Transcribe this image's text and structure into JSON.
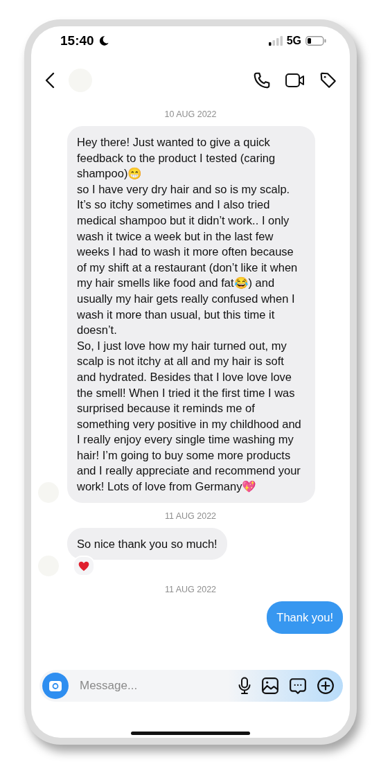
{
  "status_bar": {
    "time": "15:40",
    "network": "5G"
  },
  "messages": [
    {
      "kind": "date",
      "text": "10 AUG 2022"
    },
    {
      "kind": "incoming",
      "text": "Hey there! Just wanted to give a quick feedback to the product I tested (caring shampoo)😁\nso I have very dry hair and so is my scalp. It’s so itchy sometimes and I also tried medical shampoo but it didn’t work.. I only wash it twice a week but in the last few weeks I had to wash it more often because of my shift at a restaurant (don’t like it when my hair smells like food and fat😂) and usually my hair gets really confused when I wash it more than usual, but this time it doesn’t.\nSo, I just love how my hair turned out, my scalp is not itchy at all and my hair is soft and hydrated. Besides that I love love love the smell! When I tried it the first time I was surprised because it reminds me of something very positive in my childhood and I really enjoy every single time washing my hair! I’m going to buy some more products and I really appreciate and recommend your work! Lots of love from Germany💖",
      "reaction": false
    },
    {
      "kind": "date",
      "text": "11 AUG 2022"
    },
    {
      "kind": "incoming",
      "text": "So nice thank you so much!",
      "reaction": true
    },
    {
      "kind": "date",
      "text": "11 AUG 2022"
    },
    {
      "kind": "outgoing",
      "text": "Thank you!"
    }
  ],
  "composer": {
    "placeholder": "Message..."
  }
}
